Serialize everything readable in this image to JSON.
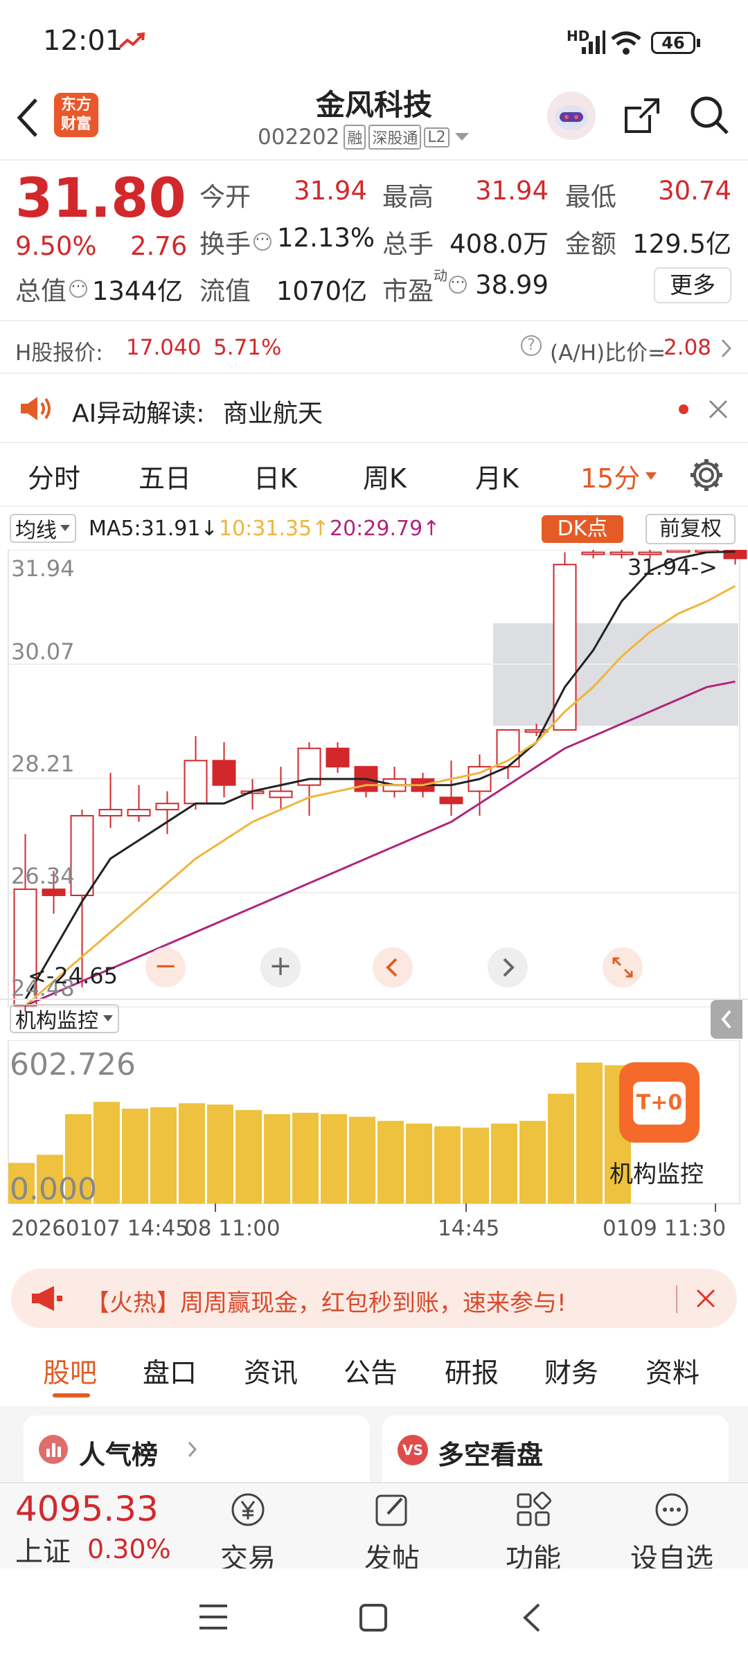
{
  "status": {
    "time": "12:01",
    "battery": "46",
    "hd": "HD"
  },
  "header": {
    "title": "金风科技",
    "code": "002202",
    "badge_rong": "融",
    "badge_sgt": "深股通",
    "badge_l2": "L2",
    "logo_line1": "东方",
    "logo_line2": "财富"
  },
  "quote": {
    "price": "31.80",
    "pct": "9.50%",
    "change": "2.76",
    "jinkai_label": "今开",
    "jinkai": "31.94",
    "zuigao_label": "最高",
    "zuigao": "31.94",
    "zuidi_label": "最低",
    "zuidi": "30.74",
    "huanshou_label": "换手",
    "huanshou": "12.13%",
    "zongshou_label": "总手",
    "zongshou": "408.0万",
    "jine_label": "金额",
    "jine": "129.5亿",
    "zongzhi_label": "总值",
    "zongzhi": "1344亿",
    "liuzhi_label": "流值",
    "liuzhi": "1070亿",
    "shiying_label": "市盈",
    "shiying_sup": "动",
    "shiying": "38.99",
    "more": "更多"
  },
  "hshare": {
    "label": "H股报价:",
    "price": "17.040",
    "pct": "5.71%",
    "ratio_label": "(A/H)比价=",
    "ratio": "2.08"
  },
  "ai": {
    "label": "AI异动解读:",
    "text": "商业航天"
  },
  "tabs": {
    "t1": "分时",
    "t2": "五日",
    "t3": "日K",
    "t4": "周K",
    "t5": "月K",
    "t6": "15分"
  },
  "chart": {
    "ma_select": "均线",
    "ma5": "MA5:31.91↓",
    "ma10": "10:31.35↑",
    "ma20": "20:29.79↑",
    "dk": "DK点",
    "fq": "前复权",
    "y1": "31.94",
    "y2": "30.07",
    "y3": "28.21",
    "y4": "26.34",
    "y5": "24.48",
    "max_label": "31.94->",
    "min_label": "<-24.65",
    "vol_select": "机构监控",
    "vol_max": "602.726",
    "vol_min": "0.000",
    "x1": "20260107 14:45",
    "x2": "08 11:00",
    "x3": "14:45",
    "x4": "0109 11:30",
    "inst_label": "机构监控",
    "t0": "T+0"
  },
  "chart_data": {
    "type": "candlestick",
    "candles": [
      [
        24.5,
        26.4,
        27.3,
        24.4
      ],
      [
        26.4,
        26.3,
        26.7,
        26.0
      ],
      [
        26.3,
        27.6,
        27.7,
        24.8
      ],
      [
        27.6,
        27.7,
        28.3,
        27.4
      ],
      [
        27.6,
        27.7,
        28.1,
        27.5
      ],
      [
        27.7,
        27.8,
        28.0,
        27.3
      ],
      [
        27.8,
        28.5,
        28.9,
        27.7
      ],
      [
        28.5,
        28.1,
        28.8,
        27.9
      ],
      [
        28.0,
        28.0,
        28.2,
        27.7
      ],
      [
        27.9,
        28.0,
        28.4,
        27.7
      ],
      [
        28.1,
        28.7,
        28.8,
        27.6
      ],
      [
        28.7,
        28.4,
        28.8,
        28.3
      ],
      [
        28.4,
        28.0,
        28.4,
        27.9
      ],
      [
        28.0,
        28.2,
        28.4,
        27.9
      ],
      [
        28.2,
        28.0,
        28.3,
        27.9
      ],
      [
        27.9,
        27.8,
        28.5,
        27.6
      ],
      [
        28.0,
        28.4,
        28.6,
        27.6
      ],
      [
        28.4,
        29.0,
        29.0,
        28.2
      ],
      [
        29.0,
        29.0,
        29.1,
        28.9
      ],
      [
        29.0,
        31.7,
        31.9,
        29.1
      ],
      [
        31.9,
        31.9,
        31.94,
        31.8
      ],
      [
        31.9,
        31.9,
        31.94,
        31.8
      ],
      [
        31.9,
        31.9,
        31.94,
        31.8
      ],
      [
        31.94,
        31.94,
        31.94,
        31.9
      ],
      [
        31.94,
        31.94,
        31.94,
        31.9
      ],
      [
        31.94,
        31.8,
        31.94,
        31.7
      ]
    ],
    "ma5": [
      24.6,
      25.4,
      26.2,
      26.9,
      27.2,
      27.5,
      27.8,
      27.8,
      28.0,
      28.1,
      28.2,
      28.2,
      28.2,
      28.1,
      28.1,
      28.1,
      28.2,
      28.4,
      28.8,
      29.7,
      30.3,
      31.1,
      31.6,
      31.8,
      31.9,
      31.91
    ],
    "ma10": [
      24.5,
      24.9,
      25.3,
      25.7,
      26.1,
      26.5,
      26.9,
      27.2,
      27.5,
      27.7,
      27.9,
      28.0,
      28.1,
      28.1,
      28.1,
      28.2,
      28.3,
      28.5,
      28.8,
      29.3,
      29.7,
      30.2,
      30.6,
      30.9,
      31.1,
      31.35
    ],
    "ma20": [
      24.5,
      24.7,
      24.9,
      25.1,
      25.3,
      25.5,
      25.7,
      25.9,
      26.1,
      26.3,
      26.5,
      26.7,
      26.9,
      27.1,
      27.3,
      27.5,
      27.8,
      28.1,
      28.4,
      28.7,
      28.9,
      29.1,
      29.3,
      29.5,
      29.7,
      29.79
    ],
    "volume": [
      150,
      180,
      330,
      375,
      350,
      355,
      370,
      365,
      345,
      330,
      335,
      330,
      320,
      305,
      295,
      285,
      280,
      295,
      305,
      405,
      520,
      510,
      0,
      0,
      0,
      0
    ],
    "ylim": [
      24.48,
      31.94
    ],
    "vol_ylim": [
      0,
      602.726
    ]
  },
  "promo": {
    "text": "【火热】周周赢现金，红包秒到账，速来参与!"
  },
  "subtabs": {
    "s1": "股吧",
    "s2": "盘口",
    "s3": "资讯",
    "s4": "公告",
    "s5": "研报",
    "s6": "财务",
    "s7": "资料"
  },
  "cards": {
    "popular": "人气榜",
    "duokong": "多空看盘",
    "vs": "VS"
  },
  "bottom": {
    "index_value": "4095.33",
    "index_name": "上证",
    "index_pct": "0.30%",
    "trade": "交易",
    "post": "发帖",
    "func": "功能",
    "watch": "设自选"
  },
  "colors": {
    "red": "#d2282c",
    "orange": "#e45b25",
    "ma5": "#222222",
    "ma10": "#f0b43c",
    "ma20": "#b1247b",
    "vol": "#eec23e"
  }
}
